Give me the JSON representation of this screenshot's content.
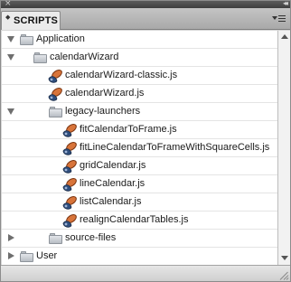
{
  "panel": {
    "tab_label": "SCRIPTS",
    "close_glyph": "×",
    "collapse_glyph": "◂◂",
    "tab_arrows_glyph": "◆"
  },
  "tree": {
    "application": "Application",
    "calendarWizard": "calendarWizard",
    "calendarWizard_classic": "calendarWizard-classic.js",
    "calendarWizard_js": "calendarWizard.js",
    "legacy_launchers": "legacy-launchers",
    "fitCalendarToFrame": "fitCalendarToFrame.js",
    "fitLineCalendar": "fitLineCalendarToFrameWithSquareCells.js",
    "gridCalendar": "gridCalendar.js",
    "lineCalendar": "lineCalendar.js",
    "listCalendar": "listCalendar.js",
    "realignCalendarTables": "realignCalendarTables.js",
    "source_files": "source-files",
    "user": "User"
  },
  "icons": {
    "folder": "folder-icon",
    "script": "script-icon",
    "expanded": "disclosure-expanded-icon",
    "collapsed": "disclosure-collapsed-icon",
    "panel_menu": "panel-menu-icon",
    "resize": "resize-grip-icon"
  },
  "colors": {
    "scroll_icon_orange": "#d8743a",
    "scroll_icon_blue": "#2f4e7d",
    "folder_fill": "#c9ced4"
  }
}
